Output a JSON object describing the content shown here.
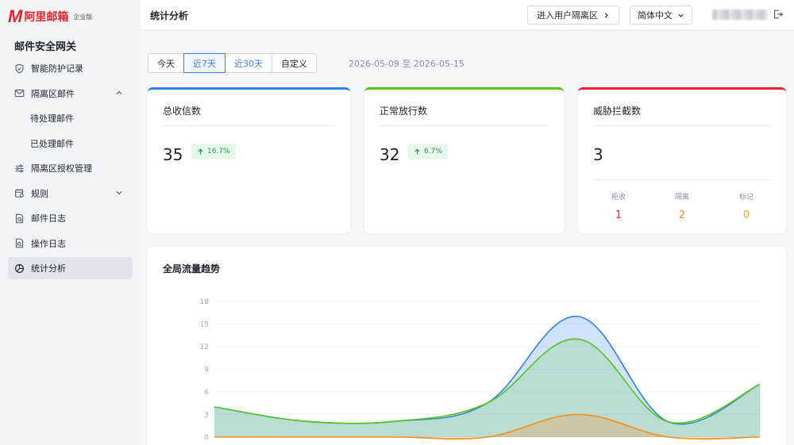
{
  "brand": {
    "name": "阿里邮箱",
    "edition": "企业版",
    "accent": "#e8232b"
  },
  "sidebar": {
    "title": "邮件安全网关",
    "items": [
      {
        "label": "智能防护记录",
        "icon": "shield-icon"
      },
      {
        "label": "隔离区邮件",
        "icon": "mail-icon",
        "expanded": true
      },
      {
        "label": "待处理邮件",
        "sub": true
      },
      {
        "label": "已处理邮件",
        "sub": true
      },
      {
        "label": "隔离区授权管理",
        "icon": "sliders-icon"
      },
      {
        "label": "规则",
        "icon": "rules-icon",
        "expanded": false
      },
      {
        "label": "邮件日志",
        "icon": "log-icon"
      },
      {
        "label": "操作日志",
        "icon": "oplog-icon"
      },
      {
        "label": "统计分析",
        "icon": "pie-icon",
        "active": true
      }
    ]
  },
  "header": {
    "title": "统计分析",
    "quarantine_button": "进入用户隔离区",
    "language": "简体中文"
  },
  "toolbar": {
    "ranges": [
      "今天",
      "近7天",
      "近30天",
      "自定义"
    ],
    "selected": "近7天",
    "date_range": "2026-05-09 至 2026-05-15"
  },
  "cards": {
    "total": {
      "title": "总收信数",
      "value": "35",
      "change": "16.7%",
      "color": "#2f7ff2"
    },
    "normal": {
      "title": "正常放行数",
      "value": "32",
      "change": "6.7%",
      "color": "#52c41a"
    },
    "threat": {
      "title": "威胁拦截数",
      "value": "3",
      "color": "#f5222d",
      "breakdown": [
        {
          "label": "拒收",
          "value": "1",
          "color": "#f5222d"
        },
        {
          "label": "隔离",
          "value": "2",
          "color": "#fa8c16"
        },
        {
          "label": "标记",
          "value": "0",
          "color": "#faad14"
        }
      ]
    }
  },
  "chart_data": {
    "type": "area",
    "title": "全局流量趋势",
    "ylim": [
      0,
      18
    ],
    "y_ticks": [
      0,
      3,
      6,
      9,
      12,
      15,
      18
    ],
    "grid": true,
    "x": [
      0,
      1,
      2,
      3,
      4,
      5,
      6
    ],
    "series": [
      {
        "values": [
          4,
          2.1,
          2.1,
          4.5,
          16,
          2,
          7
        ],
        "color": "#2f7ff2"
      },
      {
        "values": [
          4,
          2.1,
          2.1,
          4.5,
          13,
          2,
          7
        ],
        "color": "#52c41a"
      },
      {
        "values": [
          0,
          0,
          0,
          0,
          3,
          0,
          0
        ],
        "color": "#fa8c16"
      }
    ]
  }
}
